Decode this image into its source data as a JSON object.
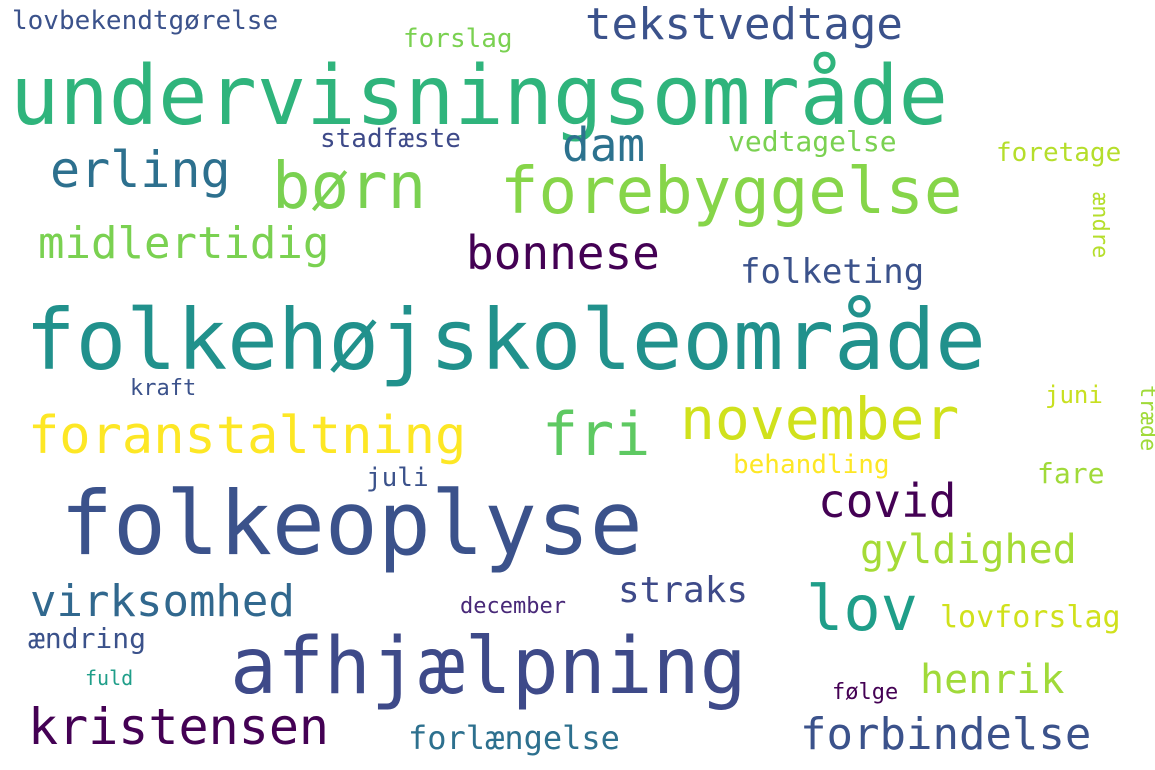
{
  "words": [
    "undervisningsområde",
    "folkehøjskoleområde",
    "folkeoplyse",
    "afhjælpning",
    "børn",
    "forebyggelse",
    "tekstvedtage",
    "erling",
    "dam",
    "midlertidig",
    "bonnese",
    "folketing",
    "foranstaltning",
    "fri",
    "november",
    "covid",
    "gyldighed",
    "virksomhed",
    "straks",
    "lov",
    "henrik",
    "kristensen",
    "forbindelse",
    "lovbekendtgørelse",
    "forslag",
    "stadfæste",
    "vedtagelse",
    "foretage",
    "kraft",
    "juni",
    "behandling",
    "juli",
    "fare",
    "december",
    "lovforslag",
    "ændring",
    "fuld",
    "følge",
    "forlængelse",
    "ændre",
    "træde"
  ],
  "palette": {
    "background": "#ffffff",
    "colormap": "viridis"
  }
}
